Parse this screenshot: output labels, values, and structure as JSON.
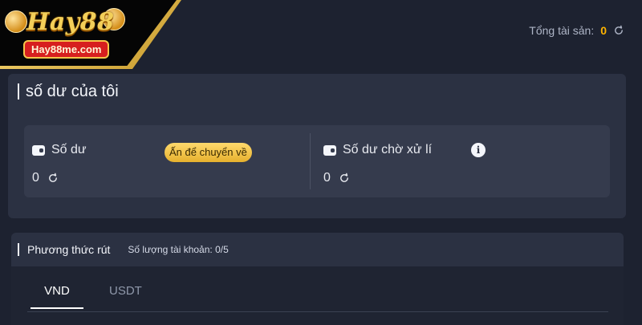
{
  "brand": {
    "logo_title": "Hay88",
    "logo_subtitle": "Hay88me.com"
  },
  "header": {
    "total_assets_label": "Tổng tài sản:",
    "total_assets_value": "0"
  },
  "balance_panel": {
    "title": "số dư của tôi",
    "balance_label": "Số dư",
    "transfer_button": "Ấn để chuyển về",
    "balance_value": "0",
    "pending_label": "Số dư chờ xử lí",
    "pending_value": "0",
    "info_glyph": "i"
  },
  "withdraw_panel": {
    "title": "Phương thức rút",
    "account_count_label": "Số lượng tài khoản:",
    "account_count_value": "0/5",
    "tabs": [
      "VND",
      "USDT"
    ],
    "active_tab": "VND"
  },
  "colors": {
    "accent": "#ffb400",
    "button_gold": "#f2c247",
    "background": "#1d2230"
  }
}
